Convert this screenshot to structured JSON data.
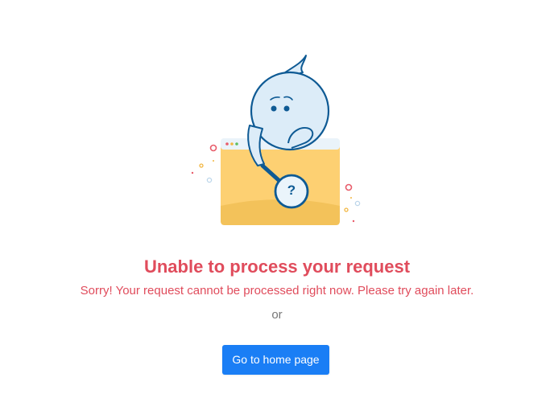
{
  "error": {
    "title": "Unable to process your request",
    "message": "Sorry! Your request cannot be processed right now. Please try again later.",
    "separator": "or",
    "home_button_label": "Go to home page",
    "question_mark": "?"
  },
  "colors": {
    "title": "#e04c5c",
    "button": "#1a7ef5",
    "folder": "#fdd072",
    "outline": "#0e5a94",
    "face": "#dcecf8"
  }
}
